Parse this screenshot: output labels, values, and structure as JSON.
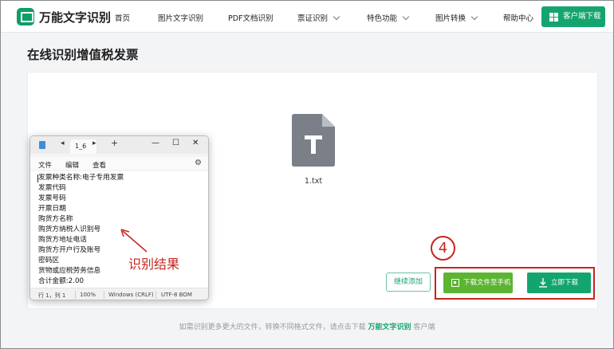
{
  "header": {
    "brand": "万能文字识别",
    "nav": [
      {
        "label": "首页"
      },
      {
        "label": "图片文字识别"
      },
      {
        "label": "PDF文档识别"
      },
      {
        "label": "票证识别"
      },
      {
        "label": "特色功能"
      },
      {
        "label": "图片转换"
      },
      {
        "label": "帮助中心"
      }
    ],
    "client_download": "客户端下载"
  },
  "page_title": "在线识别增值税发票",
  "file": {
    "name": "1.txt",
    "icon": "text-file-icon"
  },
  "actions": {
    "continue_add": "继续添加",
    "download_to_phone": "下载文件至手机",
    "download_now": "立即下载"
  },
  "annotation": {
    "step": "4",
    "result_label": "识别结果",
    "color": "#c6261d"
  },
  "footer": {
    "prefix": "如需识别更多更大的文件，转换不同格式文件，请点击下载",
    "brand": "万能文字识别",
    "suffix": "客户端"
  },
  "notepad": {
    "tab": "1_6",
    "menu": [
      "文件",
      "编辑",
      "查看"
    ],
    "lines": [
      "发票种类名称:电子专用发票",
      "发票代码",
      "发票号码",
      "开票日期",
      "购货方名称",
      "购货方纳税人识别号",
      "购货方地址电话",
      "购货方开户行及账号",
      "密码区",
      "货物或应税劳务信息",
      "合计金额:2.00"
    ],
    "status": {
      "position": "行 1，列 1",
      "zoom": "100%",
      "line_ending": "Windows (CRLF)",
      "encoding": "UTF-8 BOM"
    }
  },
  "colors": {
    "brand_green": "#14a56f",
    "phone_green": "#5cb531",
    "annotation_red": "#c6261d"
  }
}
